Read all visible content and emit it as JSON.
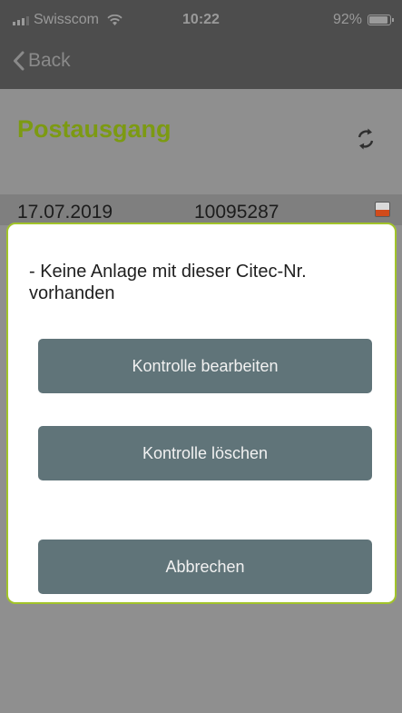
{
  "status_bar": {
    "carrier": "Swisscom",
    "time": "10:22",
    "battery_percent": "92%",
    "battery_level": 0.92
  },
  "nav": {
    "back_label": "Back"
  },
  "page": {
    "title": "Postausgang"
  },
  "list": {
    "rows": [
      {
        "date": "17.07.2019",
        "number": "10095287"
      }
    ]
  },
  "dialog": {
    "message": "- Keine Anlage mit dieser Citec-Nr. vorhanden",
    "buttons": {
      "edit": "Kontrolle bearbeiten",
      "delete": "Kontrolle löschen",
      "cancel": "Abbrechen"
    }
  },
  "icons": {
    "back": "chevron-left-icon",
    "refresh": "refresh-icon",
    "wifi": "wifi-icon",
    "signal": "signal-icon",
    "battery": "battery-icon",
    "row_status": "status-indicator-icon"
  },
  "colors": {
    "accent_green": "#7c9a12",
    "dialog_border": "#a2c42a",
    "button_bg": "#607479",
    "status_indicator": "#d14b1b"
  }
}
